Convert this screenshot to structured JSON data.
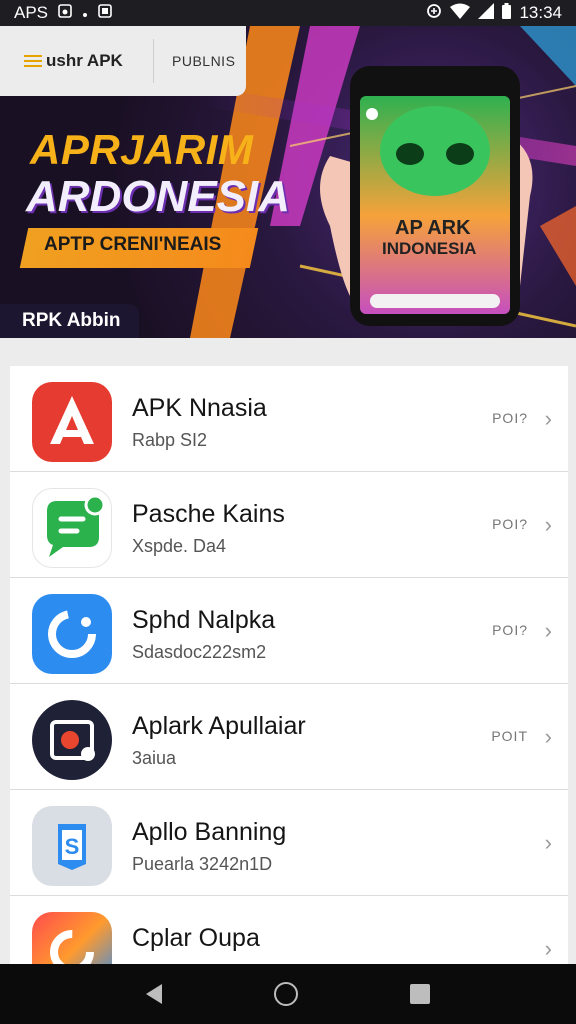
{
  "status_bar": {
    "left_text": "APS",
    "time": "13:34"
  },
  "header": {
    "brand": "ushr APK",
    "tab": "PUBLNIS"
  },
  "banner": {
    "headline1": "APRJARIM",
    "headline2": "ARDONESIA",
    "ribbon": "APTP CRENI'NEAIS",
    "corner_label": "RPK Abbin",
    "phone_text_1": "AP ARK",
    "phone_text_2": "INDONESIA"
  },
  "apps": [
    {
      "name": "APK Nnasia",
      "sub": "Rabp SI2",
      "meta": "POI?",
      "icon": "red-a-icon",
      "color": "#e53b30"
    },
    {
      "name": "Pasche Kains",
      "sub": "Xspde. Da4",
      "meta": "POI?",
      "icon": "green-chat-icon",
      "color": "#2bb24c"
    },
    {
      "name": "Sphd Nalpka",
      "sub": "Sdasdoc222sm2",
      "meta": "POI?",
      "icon": "blue-c-icon",
      "color": "#2d8cf0"
    },
    {
      "name": "Aplark Apullaiar",
      "sub": "3aiua",
      "meta": "POIT",
      "icon": "record-icon",
      "color": "#1f2236"
    },
    {
      "name": "Apllo Banning",
      "sub": "Puearla 3242n1D",
      "meta": "",
      "icon": "s-shield-icon",
      "color": "#d9dde4"
    },
    {
      "name": "Cplar Oupa",
      "sub": "",
      "meta": "",
      "icon": "colorful-c-icon",
      "color": "#ff8a30"
    }
  ]
}
